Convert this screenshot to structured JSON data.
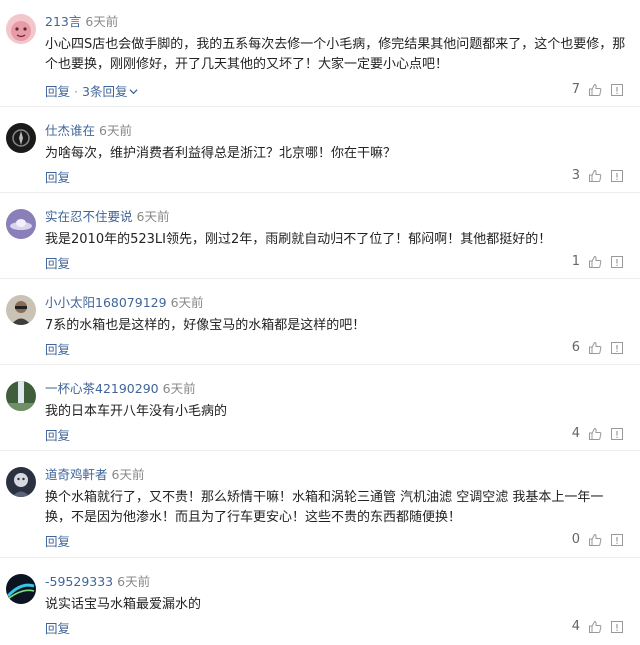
{
  "colors": {
    "username": "#406599",
    "link": "#406599",
    "meta": "#888888",
    "text": "#222222",
    "divider": "#ececec"
  },
  "actions": {
    "reply_label": "回复"
  },
  "comments": [
    {
      "user": "213言",
      "time": "6天前",
      "text": "小心四S店也会做手脚的，我的五系每次去修一个小毛病，修完结果其他问题都来了，这个也要修，那个也要换，刚刚修好，开了几天其他的又坏了！大家一定要小心点吧！",
      "likes": "7",
      "replies_label": "3条回复",
      "avatar_icon": "pink-face-avatar-icon"
    },
    {
      "user": "仕杰谁在",
      "time": "6天前",
      "text": "为啥每次，维护消费者利益得总是浙江？北京哪！你在干嘛？",
      "likes": "3",
      "avatar_icon": "dark-emblem-avatar-icon"
    },
    {
      "user": "实在忍不住要说",
      "time": "6天前",
      "text": "我是2010年的523LI领先，刚过2年，雨刷就自动归不了位了！郁闷啊！其他都挺好的！",
      "likes": "1",
      "avatar_icon": "ufo-avatar-icon"
    },
    {
      "user": "小小太阳168079129",
      "time": "6天前",
      "text": "7系的水箱也是这样的，好像宝马的水箱都是这样的吧！",
      "likes": "6",
      "avatar_icon": "person-photo-avatar-icon"
    },
    {
      "user": "一杯心茶42190290",
      "time": "6天前",
      "text": "我的日本车开八年没有小毛病的",
      "likes": "4",
      "avatar_icon": "waterfall-avatar-icon"
    },
    {
      "user": "道奇鸡軒者",
      "time": "6天前",
      "text": "换个水箱就行了，又不贵！那么矫情干嘛！水箱和涡轮三通管 汽机油滤 空调空滤 我基本上一年一换，不是因为他渗水！而且为了行车更安心！这些不贵的东西都随便换！",
      "likes": "0",
      "avatar_icon": "dark-portrait-avatar-icon"
    },
    {
      "user": "-59529333",
      "time": "6天前",
      "text": "说实话宝马水箱最爱漏水的",
      "likes": "4",
      "avatar_icon": "light-trail-avatar-icon"
    }
  ]
}
